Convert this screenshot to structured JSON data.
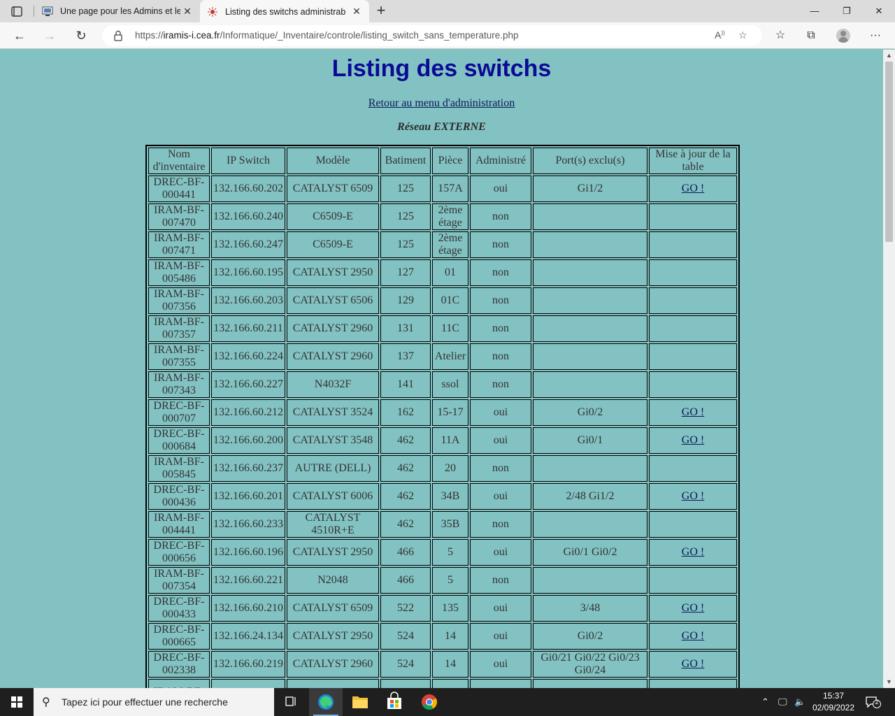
{
  "browser": {
    "tabs": [
      {
        "title": "Une page pour les Admins et les",
        "active": false
      },
      {
        "title": "Listing des switchs administrable",
        "active": true
      }
    ],
    "url": {
      "prefix": "https://",
      "host": "iramis-i.cea.fr",
      "path": "/Informatique/_Inventaire/controle/listing_switch_sans_temperature.php"
    }
  },
  "page": {
    "title": "Listing des switchs",
    "back_link": "Retour au menu d'administration",
    "network": "Réseau EXTERNE"
  },
  "table": {
    "headers": [
      "Nom d'inventaire",
      "IP Switch",
      "Modèle",
      "Batiment",
      "Pièce",
      "Administré",
      "Port(s) exclu(s)",
      "Mise à jour de la table"
    ],
    "rows": [
      {
        "nom": "DREC-BF-000441",
        "ip": "132.166.60.202",
        "modele": "CATALYST 6509",
        "batiment": "125",
        "piece": "157A",
        "admin": "oui",
        "ports": "Gi1/2",
        "maj": "GO !"
      },
      {
        "nom": "IRAM-BF-007470",
        "ip": "132.166.60.240",
        "modele": "C6509-E",
        "batiment": "125",
        "piece": "2ème étage",
        "admin": "non",
        "ports": "",
        "maj": ""
      },
      {
        "nom": "IRAM-BF-007471",
        "ip": "132.166.60.247",
        "modele": "C6509-E",
        "batiment": "125",
        "piece": "2ème étage",
        "admin": "non",
        "ports": "",
        "maj": ""
      },
      {
        "nom": "IRAM-BF-005486",
        "ip": "132.166.60.195",
        "modele": "CATALYST 2950",
        "batiment": "127",
        "piece": "01",
        "admin": "non",
        "ports": "",
        "maj": ""
      },
      {
        "nom": "IRAM-BF-007356",
        "ip": "132.166.60.203",
        "modele": "CATALYST 6506",
        "batiment": "129",
        "piece": "01C",
        "admin": "non",
        "ports": "",
        "maj": ""
      },
      {
        "nom": "IRAM-BF-007357",
        "ip": "132.166.60.211",
        "modele": "CATALYST 2960",
        "batiment": "131",
        "piece": "11C",
        "admin": "non",
        "ports": "",
        "maj": ""
      },
      {
        "nom": "IRAM-BF-007355",
        "ip": "132.166.60.224",
        "modele": "CATALYST 2960",
        "batiment": "137",
        "piece": "Atelier",
        "admin": "non",
        "ports": "",
        "maj": ""
      },
      {
        "nom": "IRAM-BF-007343",
        "ip": "132.166.60.227",
        "modele": "N4032F",
        "batiment": "141",
        "piece": "ssol",
        "admin": "non",
        "ports": "",
        "maj": ""
      },
      {
        "nom": "DREC-BF-000707",
        "ip": "132.166.60.212",
        "modele": "CATALYST 3524",
        "batiment": "162",
        "piece": "15-17",
        "admin": "oui",
        "ports": "Gi0/2",
        "maj": "GO !"
      },
      {
        "nom": "DREC-BF-000684",
        "ip": "132.166.60.200",
        "modele": "CATALYST 3548",
        "batiment": "462",
        "piece": "11A",
        "admin": "oui",
        "ports": "Gi0/1",
        "maj": "GO !"
      },
      {
        "nom": "IRAM-BF-005845",
        "ip": "132.166.60.237",
        "modele": "AUTRE (DELL)",
        "batiment": "462",
        "piece": "20",
        "admin": "non",
        "ports": "",
        "maj": ""
      },
      {
        "nom": "DREC-BF-000436",
        "ip": "132.166.60.201",
        "modele": "CATALYST 6006",
        "batiment": "462",
        "piece": "34B",
        "admin": "oui",
        "ports": "2/48 Gi1/2",
        "maj": "GO !"
      },
      {
        "nom": "IRAM-BF-004441",
        "ip": "132.166.60.233",
        "modele": "CATALYST 4510R+E",
        "batiment": "462",
        "piece": "35B",
        "admin": "non",
        "ports": "",
        "maj": ""
      },
      {
        "nom": "DREC-BF-000656",
        "ip": "132.166.60.196",
        "modele": "CATALYST 2950",
        "batiment": "466",
        "piece": "5",
        "admin": "oui",
        "ports": "Gi0/1 Gi0/2",
        "maj": "GO !"
      },
      {
        "nom": "IRAM-BF-007354",
        "ip": "132.166.60.221",
        "modele": "N2048",
        "batiment": "466",
        "piece": "5",
        "admin": "non",
        "ports": "",
        "maj": ""
      },
      {
        "nom": "DREC-BF-000433",
        "ip": "132.166.60.210",
        "modele": "CATALYST 6509",
        "batiment": "522",
        "piece": "135",
        "admin": "oui",
        "ports": "3/48",
        "maj": "GO !"
      },
      {
        "nom": "DREC-BF-000665",
        "ip": "132.166.24.134",
        "modele": "CATALYST 2950",
        "batiment": "524",
        "piece": "14",
        "admin": "oui",
        "ports": "Gi0/2",
        "maj": "GO !"
      },
      {
        "nom": "DREC-BF-002338",
        "ip": "132.166.60.219",
        "modele": "CATALYST 2960",
        "batiment": "524",
        "piece": "14",
        "admin": "oui",
        "ports": "Gi0/21 Gi0/22 Gi0/23 Gi0/24",
        "maj": "GO !"
      },
      {
        "nom": "IRAM-BF-",
        "ip": "",
        "modele": "",
        "batiment": "",
        "piece": "",
        "admin": "",
        "ports": "",
        "maj": ""
      }
    ]
  },
  "taskbar": {
    "search_placeholder": "Tapez ici pour effectuer une recherche",
    "time": "15:37",
    "date": "02/09/2022",
    "notifications": "2"
  },
  "colors": {
    "page_bg": "#83c2c2",
    "title": "#0a0a96",
    "link": "#0b1a5a"
  },
  "icons": [
    "tab-actions-icon",
    "tab-favicon",
    "close-icon",
    "new-tab-icon",
    "back-icon",
    "forward-icon",
    "refresh-icon",
    "lock-icon",
    "read-aloud-icon",
    "add-favorite-icon",
    "favorites-icon",
    "collections-icon",
    "profile-icon",
    "more-icon",
    "windows-icon",
    "search-icon",
    "task-view-icon",
    "edge-icon",
    "file-explorer-icon",
    "store-icon",
    "chrome-icon"
  ]
}
